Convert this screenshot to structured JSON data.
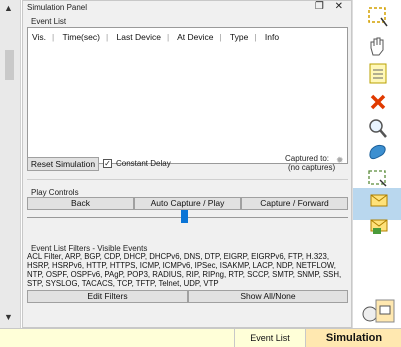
{
  "panel": {
    "title": "Simulation Panel",
    "controls": "❐ ✕"
  },
  "event_list": {
    "label": "Event List",
    "columns": [
      "Vis.",
      "Time(sec)",
      "Last Device",
      "At Device",
      "Type",
      "Info"
    ]
  },
  "controls": {
    "reset_button": "Reset Simulation",
    "constant_delay_label": "Constant Delay",
    "constant_delay_checked": true,
    "captured_to_label": "Captured to:",
    "captured_value": "(no captures)"
  },
  "play_controls": {
    "label": "Play Controls",
    "back_button": "Back",
    "auto_capture_button": "Auto Capture / Play",
    "capture_forward_button": "Capture / Forward",
    "speed_fraction": 0.49
  },
  "filters": {
    "label": "Event List Filters - Visible Events",
    "text": "ACL Filter, ARP, BGP, CDP, DHCP, DHCPv6, DNS, DTP, EIGRP, EIGRPv6, FTP, H.323, HSRP, HSRPv6, HTTP, HTTPS, ICMP, ICMPv6, IPSec, ISAKMP, LACP, NDP, NETFLOW, NTP, OSPF, OSPFv6, PAgP, POP3, RADIUS, RIP, RIPng, RTP, SCCP, SMTP, SNMP, SSH, STP, SYSLOG, TACACS, TCP, TFTP, Telnet, UDP, VTP",
    "edit_button": "Edit Filters",
    "show_all_button": "Show All/None"
  },
  "right_tools": [
    {
      "icon": "select-icon"
    },
    {
      "icon": "hand-icon"
    },
    {
      "icon": "note-icon"
    },
    {
      "icon": "delete-icon"
    },
    {
      "icon": "inspect-icon"
    },
    {
      "icon": "draw-shape-icon"
    },
    {
      "icon": "resize-icon"
    },
    {
      "icon": "add-simple-pdu-icon"
    },
    {
      "icon": "add-complex-pdu-icon"
    }
  ],
  "bottom_tabs": {
    "event_list_tab": "Event List",
    "simulation_tab": "Simulation"
  },
  "colors": {
    "accent": "#0a74d6",
    "bottom_bar": "#ffffd8",
    "active_tab": "#ffe8b0"
  }
}
